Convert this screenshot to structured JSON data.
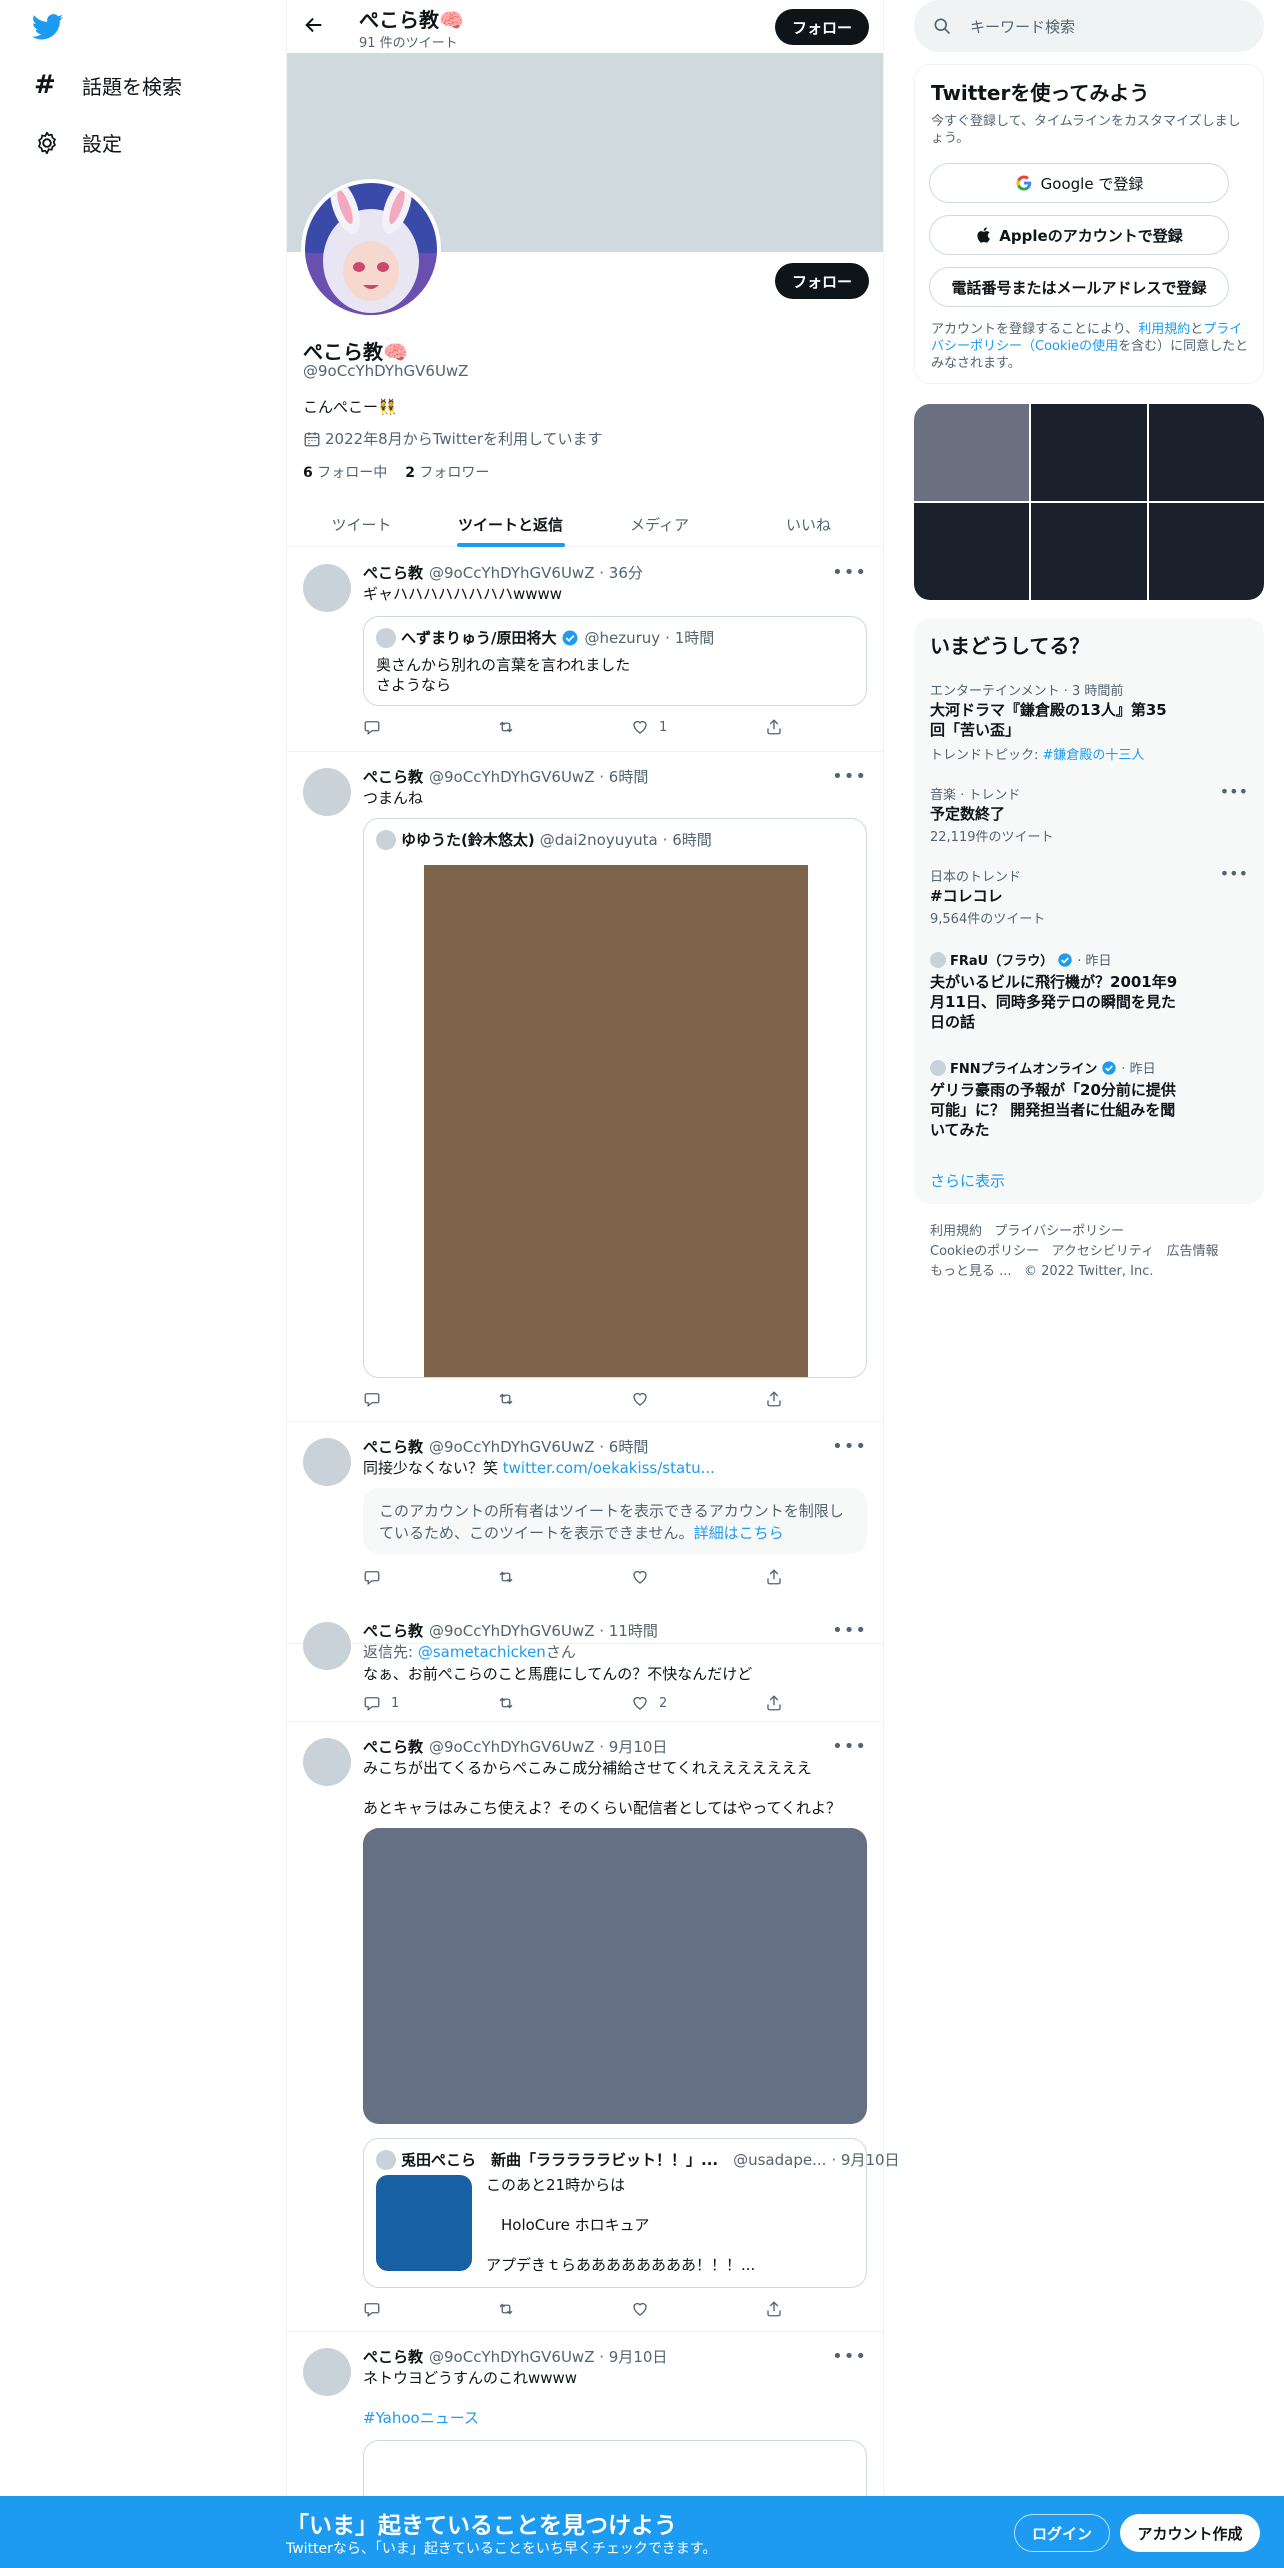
{
  "nav": {
    "explore": "話題を検索",
    "settings": "設定"
  },
  "header": {
    "name": "ぺこら教🧠",
    "tweet_count": "91 件のツイート",
    "follow": "フォロー"
  },
  "profile": {
    "name": "ぺこら教🧠",
    "handle": "@9oCcYhDYhGV6UwZ",
    "bio": "こんぺこー👯",
    "joined": "2022年8月からTwitterを利用しています",
    "following_count": "6",
    "following_label": "フォロー中",
    "followers_count": "2",
    "followers_label": "フォロワー",
    "follow": "フォロー"
  },
  "tabs": [
    "ツイート",
    "ツイートと返信",
    "メディア",
    "いいね"
  ],
  "tweets": [
    {
      "name": "ぺこら教",
      "handle": "@9oCcYhDYhGV6UwZ",
      "time": "· 36分",
      "text": "ギャハハハハハハハハwwww",
      "quote": {
        "name": "へずまりゅう/原田将大",
        "handle": "@hezuruy",
        "time": "· 1時間",
        "text": "奥さんから別れの言葉を言われました\nさようなら"
      },
      "likes": "1"
    },
    {
      "name": "ぺこら教",
      "handle": "@9oCcYhDYhGV6UwZ",
      "time": "· 6時間",
      "text": "つまんね",
      "quote": {
        "name": "ゆゆうた(鈴木悠太)",
        "handle": "@dai2noyuyuta",
        "time": "· 6時間"
      }
    },
    {
      "name": "ぺこら教",
      "handle": "@9oCcYhDYhGV6UwZ",
      "time": "· 6時間",
      "text": "同接少なくない？笑 ",
      "link": "twitter.com/oekakiss/statu...",
      "notice": "このアカウントの所有者はツイートを表示できるアカウントを制限しているため、このツイートを表示できません。",
      "notice_link": "詳細はこちら"
    },
    {
      "name": "ぺこら教",
      "handle": "@9oCcYhDYhGV6UwZ",
      "time": "· 11時間",
      "reply_prefix": "返信先: ",
      "reply_to": "@sametachicken",
      "reply_suffix": "さん",
      "text": "なぁ、お前ぺこらのこと馬鹿にしてんの？不快なんだけど",
      "replies": "1",
      "likes": "2"
    },
    {
      "name": "ぺこら教",
      "handle": "@9oCcYhDYhGV6UwZ",
      "time": "· 9月10日",
      "text": "みこちが出てくるからぺこみこ成分補給させてくれえええええええ\n\nあとキャラはみこち使えよ？そのくらい配信者としてはやってくれよ？",
      "quote": {
        "name": "兎田ぺこら　新曲「ラララララビット！！」...",
        "handle": "@usadape...",
        "time": "· 9月10日",
        "text": "このあと21時からは\n\n　HoloCure ホロキュア\n\nアプデきｔらああああああああ！！！..."
      }
    },
    {
      "name": "ぺこら教",
      "handle": "@9oCcYhDYhGV6UwZ",
      "time": "· 9月10日",
      "text": "ネトウヨどうすんのこれwwww",
      "hashtag": "#Yahooニュース"
    }
  ],
  "search": {
    "placeholder": "キーワード検索"
  },
  "signup": {
    "title": "Twitterを使ってみよう",
    "subtitle": "今すぐ登録して、タイムラインをカスタマイズしましょう。",
    "google": "Google で登録",
    "apple": "Appleのアカウントで登録",
    "phone": "電話番号またはメールアドレスで登録",
    "legal_1": "アカウントを登録することにより、",
    "legal_terms": "利用規約",
    "legal_2": "と",
    "legal_privacy": "プライバシーポリシー（Cookieの使用",
    "legal_3": "を含む）に同意したとみなされます。"
  },
  "trends": {
    "title": "いまどうしてる？",
    "items": [
      {
        "meta": "エンターテインメント · 3 時間前",
        "title": "大河ドラマ『鎌倉殿の13人』第35回「苦い盃」",
        "topic_prefix": "トレンドトピック: ",
        "topic": "#鎌倉殿の十三人"
      },
      {
        "meta": "音楽 · トレンド",
        "title": "予定数終了",
        "count": "22,119件のツイート"
      },
      {
        "meta": "日本のトレンド",
        "title": "#コレコレ",
        "count": "9,564件のツイート"
      },
      {
        "source": "FRaU（フラウ）",
        "time": "· 昨日",
        "title": "夫がいるビルに飛行機が？2001年9月11日、同時多発テロの瞬間を見た日の話"
      },
      {
        "source": "FNNプライムオンライン",
        "time": "· 昨日",
        "title": "ゲリラ豪雨の予報が「20分前に提供可能」に？ 開発担当者に仕組みを聞いてみた"
      }
    ],
    "show_more": "さらに表示"
  },
  "footer": {
    "links": [
      "利用規約",
      "プライバシーポリシー",
      "Cookieのポリシー",
      "アクセシビリティ",
      "広告情報",
      "もっと見る ..."
    ],
    "copyright": "© 2022 Twitter, Inc."
  },
  "bottom": {
    "title": "「いま」起きていることを見つけよう",
    "subtitle": "Twitterなら、「いま」起きていることをいち早くチェックできます。",
    "login": "ログイン",
    "signup": "アカウント作成"
  }
}
